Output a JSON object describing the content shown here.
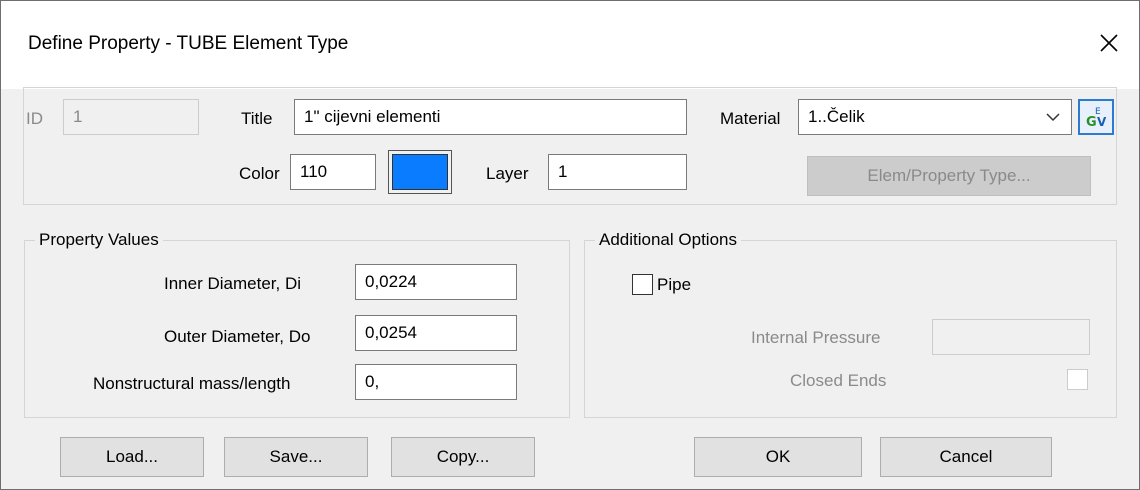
{
  "window": {
    "title": "Define Property - TUBE Element Type",
    "close_glyph": "✕"
  },
  "header": {
    "id_label": "ID",
    "id_value": "1",
    "title_label": "Title",
    "title_value": "1\" cijevni elementi",
    "material_label": "Material",
    "material_value": "1..Čelik",
    "color_label": "Color",
    "color_value": "110",
    "swatch_color": "#0a7cff",
    "layer_label": "Layer",
    "layer_value": "1",
    "elem_property_type_button": "Elem/Property Type...",
    "material_library_icon": "gv-library-icon"
  },
  "property_values": {
    "legend": "Property Values",
    "inner_label": "Inner Diameter,  Di",
    "inner_value": "0,0224",
    "outer_label": "Outer Diameter,  Do",
    "outer_value": "0,0254",
    "mass_label": "Nonstructural mass/length",
    "mass_value": "0,"
  },
  "additional_options": {
    "legend": "Additional Options",
    "pipe_label": "Pipe",
    "pipe_checked": false,
    "internal_pressure_label": "Internal Pressure",
    "internal_pressure_value": "",
    "closed_ends_label": "Closed Ends",
    "closed_ends_checked": false
  },
  "buttons": {
    "load": "Load...",
    "save": "Save...",
    "copy": "Copy...",
    "ok": "OK",
    "cancel": "Cancel"
  }
}
